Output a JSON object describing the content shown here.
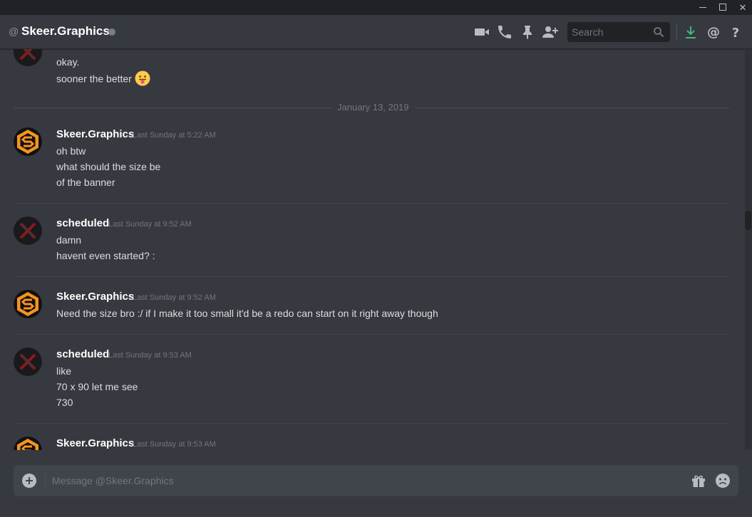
{
  "window": {
    "minimize": "minimize",
    "maximize": "maximize",
    "close": "✕"
  },
  "header": {
    "at": "@",
    "channel_name": "Skeer.Graphics",
    "search_placeholder": "Search",
    "icons": [
      "video-call-icon",
      "voice-call-icon",
      "pin-icon",
      "add-friend-icon",
      "search-icon",
      "download-icon",
      "mention-icon",
      "help-icon"
    ],
    "accent_colors": {
      "download": "#43b581",
      "status_offline": "#747f8d"
    }
  },
  "messages": {
    "first": {
      "lines": [
        "okay.",
        "sooner the better"
      ]
    },
    "date_divider": "January 13, 2019",
    "m1": {
      "user": "Skeer.Graphics",
      "time": "Last Sunday at 5:22 AM",
      "lines": [
        "oh btw",
        "what should the size be",
        "of the banner"
      ]
    },
    "m2": {
      "user": "scheduled",
      "time": "Last Sunday at 9:52 AM",
      "lines": [
        "damn",
        "havent even started? :"
      ]
    },
    "m3": {
      "user": "Skeer.Graphics",
      "time": "Last Sunday at 9:52 AM",
      "lines": [
        "Need the size bro :/ if I make it too small it'd be a redo can start on it right away though"
      ]
    },
    "m4": {
      "user": "scheduled",
      "time": "Last Sunday at 9:53 AM",
      "lines": [
        "like",
        "70 x 90 let me see",
        "730"
      ]
    },
    "m5": {
      "user": "Skeer.Graphics",
      "time": "Last Sunday at 9:53 AM"
    }
  },
  "composer": {
    "placeholder": "Message @Skeer.Graphics"
  }
}
